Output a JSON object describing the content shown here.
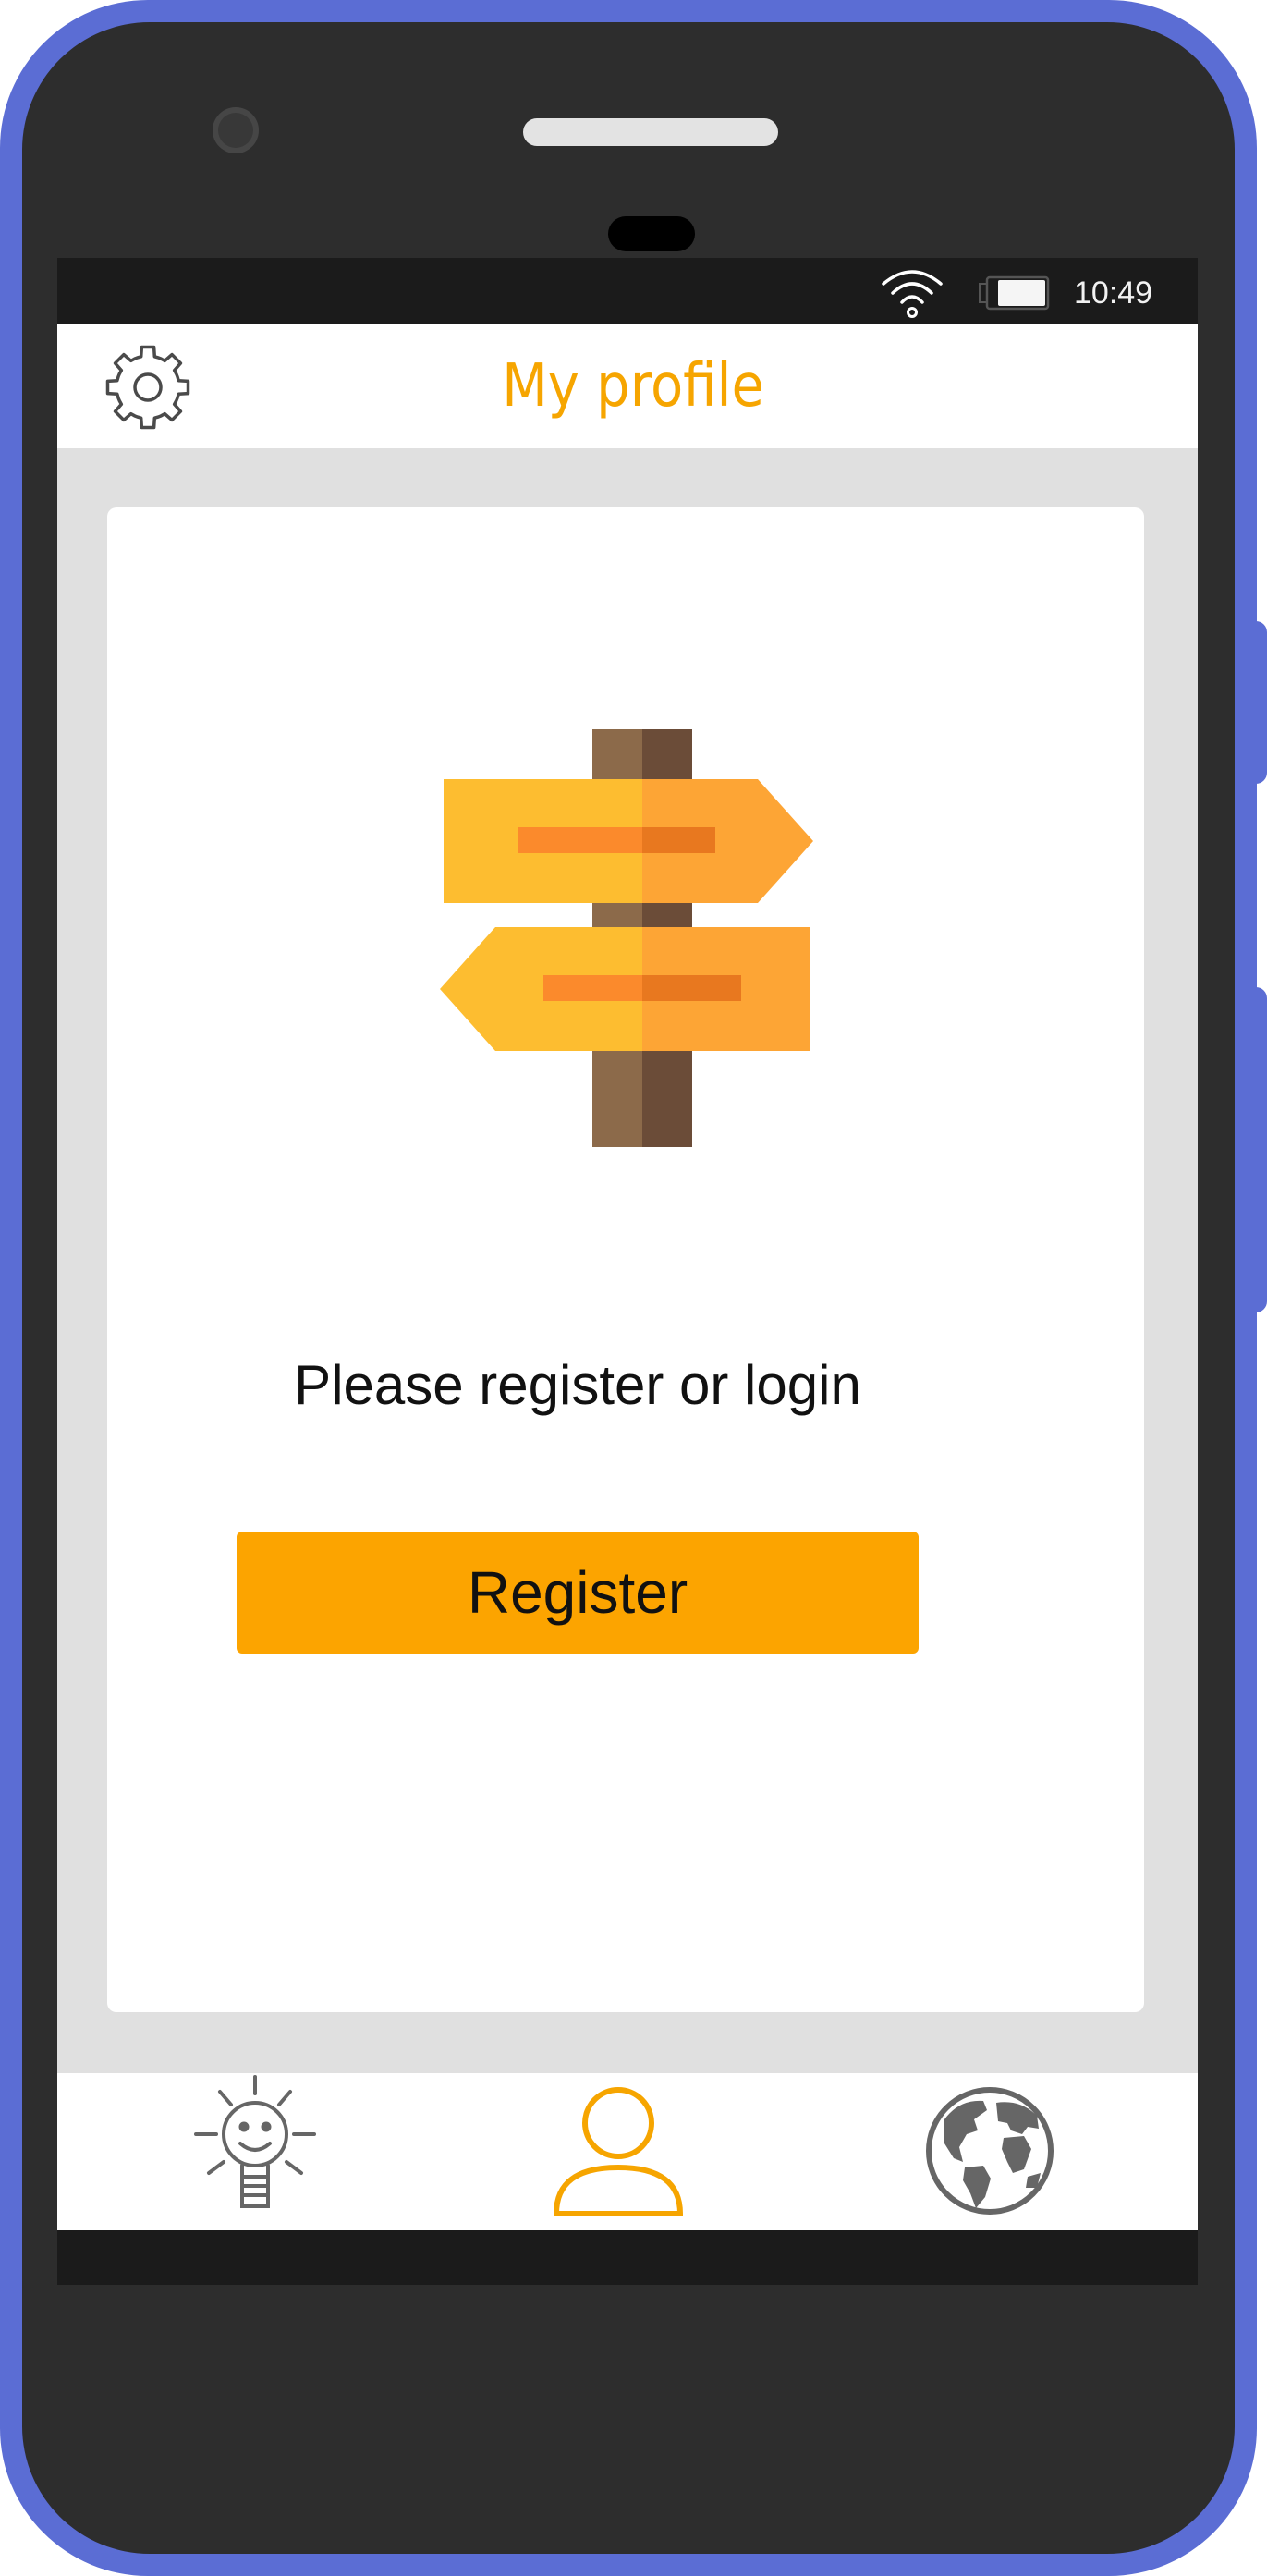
{
  "status_bar": {
    "time": "10:49",
    "icons": [
      "wifi-icon",
      "battery-icon"
    ]
  },
  "header": {
    "title": "My profile",
    "settings_icon": "gear-icon"
  },
  "main": {
    "illustration": "signpost-icon",
    "prompt": "Please register or login",
    "register_label": "Register"
  },
  "bottom_nav": {
    "items": [
      {
        "icon": "lightbulb-smile-icon",
        "active": false
      },
      {
        "icon": "user-icon",
        "active": true
      },
      {
        "icon": "globe-icon",
        "active": false
      }
    ]
  },
  "colors": {
    "accent": "#F6A500",
    "button": "#FCA400",
    "frame": "#5B6DD4",
    "phone_body": "#2D2D2D",
    "inactive_icon": "#666666"
  }
}
